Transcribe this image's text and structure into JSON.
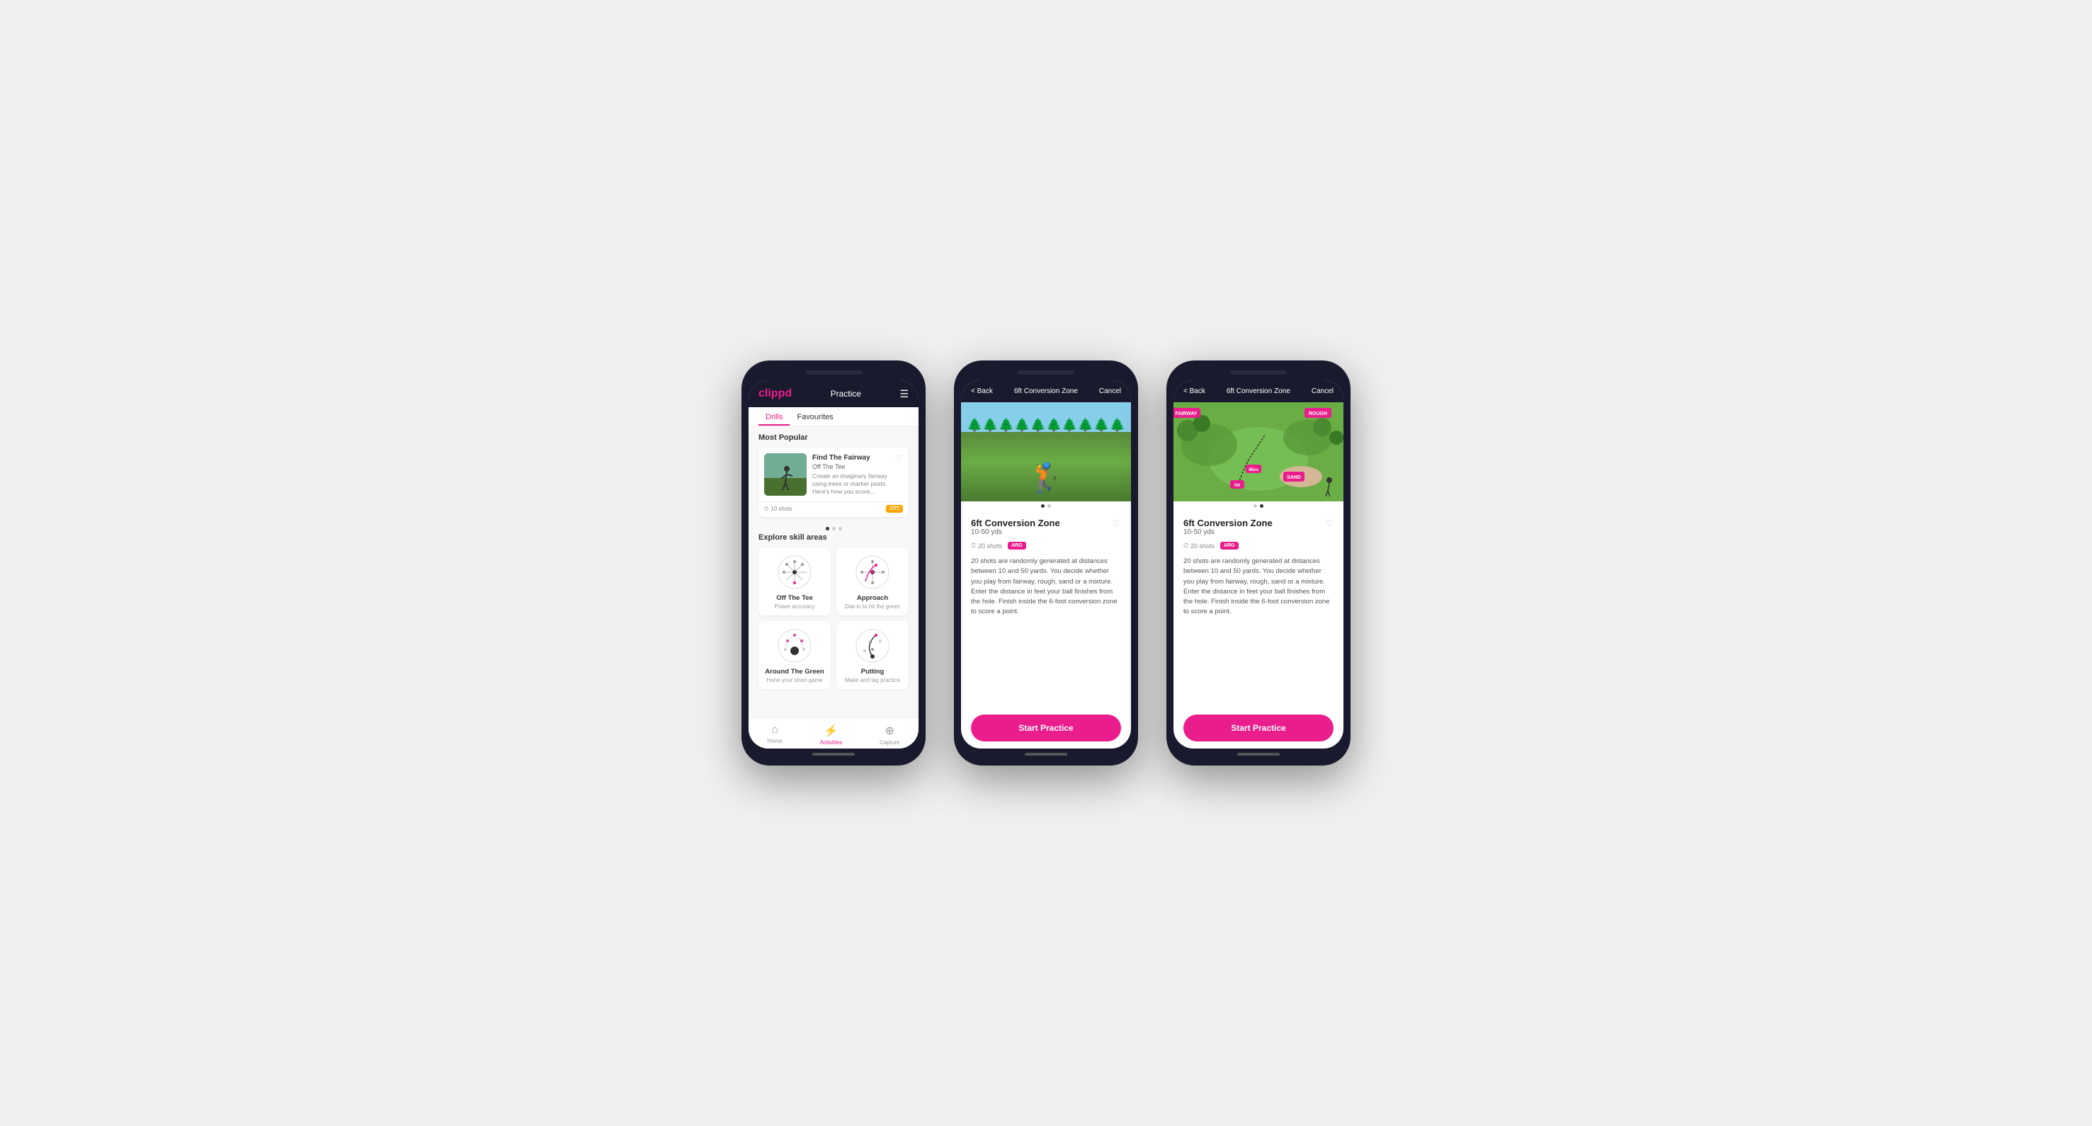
{
  "phone1": {
    "header": {
      "logo": "clippd",
      "title": "Practice",
      "menu_icon": "☰"
    },
    "tabs": [
      {
        "label": "Drills",
        "active": true
      },
      {
        "label": "Favourites",
        "active": false
      }
    ],
    "most_popular_title": "Most Popular",
    "featured_drill": {
      "title": "Find The Fairway",
      "subtitle": "Off The Tee",
      "description": "Create an imaginary fairway using trees or marker posts. Here's how you score...",
      "shots": "10 shots",
      "tag": "OTT"
    },
    "explore_title": "Explore skill areas",
    "skill_areas": [
      {
        "name": "Off The Tee",
        "desc": "Power accuracy",
        "key": "ott"
      },
      {
        "name": "Approach",
        "desc": "Dial-in to hit the green",
        "key": "approach"
      },
      {
        "name": "Around The Green",
        "desc": "Hone your short game",
        "key": "atg"
      },
      {
        "name": "Putting",
        "desc": "Make and lag practice",
        "key": "putting"
      }
    ],
    "bottom_nav": [
      {
        "label": "Home",
        "icon": "⌂",
        "active": false
      },
      {
        "label": "Activities",
        "icon": "⚡",
        "active": true
      },
      {
        "label": "Capture",
        "icon": "⊕",
        "active": false
      }
    ]
  },
  "phone2": {
    "header": {
      "back": "< Back",
      "title": "6ft Conversion Zone",
      "cancel": "Cancel"
    },
    "drill": {
      "title": "6ft Conversion Zone",
      "range": "10-50 yds",
      "shots": "20 shots",
      "tag": "ARG",
      "description": "20 shots are randomly generated at distances between 10 and 50 yards. You decide whether you play from fairway, rough, sand or a mixture. Enter the distance in feet your ball finishes from the hole. Finish inside the 6-foot conversion zone to score a point."
    },
    "start_label": "Start Practice"
  },
  "phone3": {
    "header": {
      "back": "< Back",
      "title": "6ft Conversion Zone",
      "cancel": "Cancel"
    },
    "drill": {
      "title": "6ft Conversion Zone",
      "range": "10-50 yds",
      "shots": "20 shots",
      "tag": "ARG",
      "description": "20 shots are randomly generated at distances between 10 and 50 yards. You decide whether you play from fairway, rough, sand or a mixture. Enter the distance in feet your ball finishes from the hole. Finish inside the 6-foot conversion zone to score a point."
    },
    "aerial_labels": [
      "Miss",
      "Hit",
      "SAND",
      "FAIRWAY",
      "ROUGH"
    ],
    "start_label": "Start Practice"
  }
}
